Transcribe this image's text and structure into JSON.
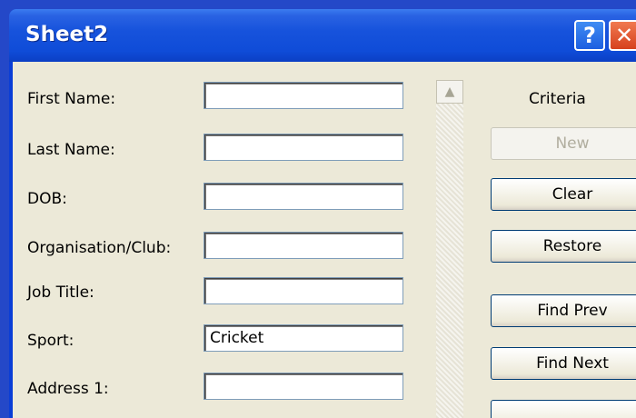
{
  "window": {
    "title": "Sheet2",
    "help_label": "?",
    "close_label": "✕"
  },
  "form": {
    "fields": [
      {
        "label": "First Name:",
        "value": ""
      },
      {
        "label": "Last Name:",
        "value": ""
      },
      {
        "label": "DOB:",
        "value": ""
      },
      {
        "label": "Organisation/Club:",
        "value": ""
      },
      {
        "label": "Job Title:",
        "value": ""
      },
      {
        "label": "Sport:",
        "value": "Cricket"
      },
      {
        "label": "Address 1:",
        "value": ""
      }
    ]
  },
  "scrollbar": {
    "up_arrow": "▲"
  },
  "sidebar": {
    "criteria_label": "Criteria",
    "buttons": {
      "new": "New",
      "clear": "Clear",
      "restore": "Restore",
      "find_prev": "Find Prev",
      "find_next": "Find Next"
    }
  }
}
